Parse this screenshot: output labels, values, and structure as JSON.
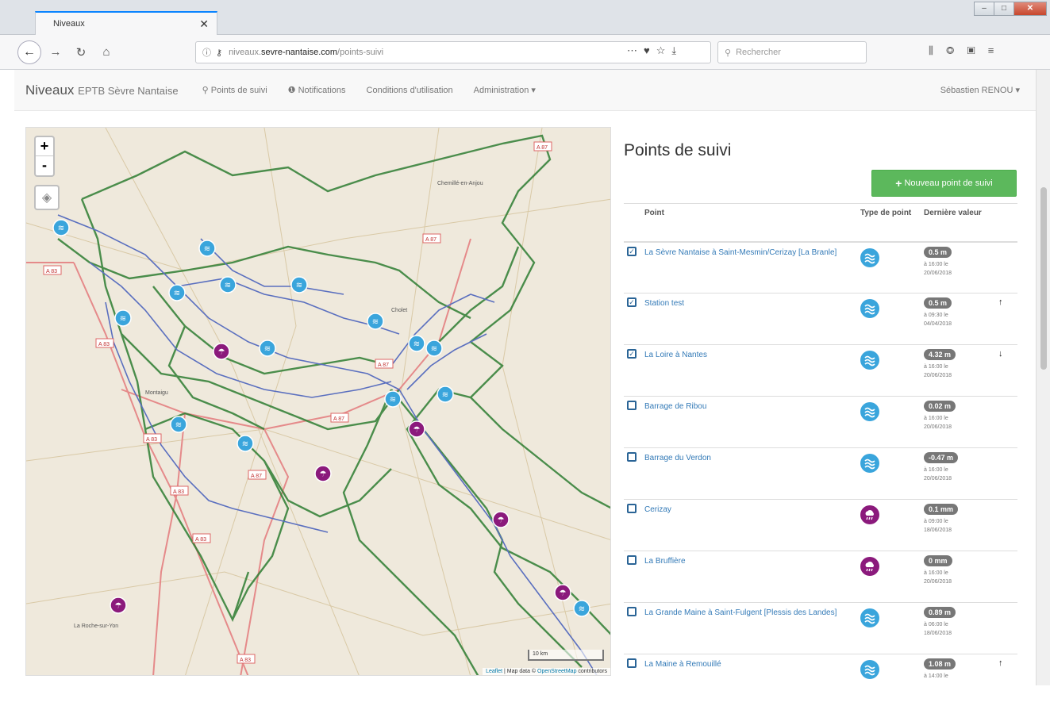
{
  "browser": {
    "tab_title": "Niveaux",
    "url_prefix": "niveaux.",
    "url_host": "sevre-nantaise.com",
    "url_path": "/points-suivi",
    "search_placeholder": "Rechercher"
  },
  "appnav": {
    "brand": "Niveaux",
    "brand_sub": "EPTB Sèvre Nantaise",
    "links": [
      "Points de suivi",
      "Notifications",
      "Conditions d'utilisation",
      "Administration"
    ],
    "user": "Sébastien RENOU"
  },
  "map": {
    "zoom_in": "+",
    "zoom_out": "-",
    "scale_label": "10 km",
    "attribution_leaflet": "Leaflet",
    "attribution_mid": " | Map data © ",
    "attribution_osm": "OpenStreetMap",
    "attribution_end": " contributors",
    "road_labels": [
      "A 87",
      "A 87",
      "A 83",
      "A 83",
      "A 87",
      "A 87",
      "A 83",
      "A 83",
      "A 87",
      "A 83",
      "A 83"
    ],
    "place_labels": [
      "Chemillé-en-Anjou",
      "La Roche-sur-Yon",
      "Cholet",
      "Montaigu"
    ]
  },
  "panel": {
    "title": "Points de suivi",
    "add_button": "Nouveau point de suivi",
    "col_point": "Point",
    "col_type": "Type de point",
    "col_value": "Dernière valeur",
    "rows": [
      {
        "checked": true,
        "name": "La Sèvre Nantaise à Saint-Mesmin/Cerizay [La Branle]",
        "type": "hydro",
        "value": "0.5 m",
        "time": "à 16:00 le",
        "date": "20/06/2018",
        "trend": ""
      },
      {
        "checked": true,
        "name": "Station test",
        "type": "hydro",
        "value": "0.5 m",
        "time": "à 09:30 le",
        "date": "04/04/2018",
        "trend": "↑"
      },
      {
        "checked": true,
        "name": "La Loire à Nantes",
        "type": "hydro",
        "value": "4.32 m",
        "time": "à 16:00 le",
        "date": "20/06/2018",
        "trend": "↓"
      },
      {
        "checked": false,
        "name": "Barrage de Ribou",
        "type": "hydro",
        "value": "0.02 m",
        "time": "à 16:00 le",
        "date": "20/06/2018",
        "trend": ""
      },
      {
        "checked": false,
        "name": "Barrage du Verdon",
        "type": "hydro",
        "value": "-0.47 m",
        "time": "à 16:00 le",
        "date": "20/06/2018",
        "trend": ""
      },
      {
        "checked": false,
        "name": "Cerizay",
        "type": "pluvio",
        "value": "0.1 mm",
        "time": "à 09:00 le",
        "date": "18/06/2018",
        "trend": ""
      },
      {
        "checked": false,
        "name": "La Bruffière",
        "type": "pluvio",
        "value": "0 mm",
        "time": "à 16:00 le",
        "date": "20/06/2018",
        "trend": ""
      },
      {
        "checked": false,
        "name": "La Grande Maine à Saint-Fulgent [Plessis des Landes]",
        "type": "hydro",
        "value": "0.89 m",
        "time": "à 06:00 le",
        "date": "18/06/2018",
        "trend": ""
      },
      {
        "checked": false,
        "name": "La Maine à Remouillé",
        "type": "hydro",
        "value": "1.08 m",
        "time": "à 14:00 le",
        "date": "",
        "trend": "↑"
      }
    ]
  },
  "colors": {
    "hydro": "#3aa5dc",
    "pluvio": "#8b1a7c",
    "link": "#337ab7",
    "green_button": "#5cb85c",
    "watershed": "#2e7d32",
    "river": "#5a6fbf",
    "road": "#e58a8a"
  },
  "icons": {
    "hydro": "waves-icon",
    "pluvio": "rain-cloud-icon",
    "checked": "check-square-icon",
    "unchecked": "square-icon"
  }
}
